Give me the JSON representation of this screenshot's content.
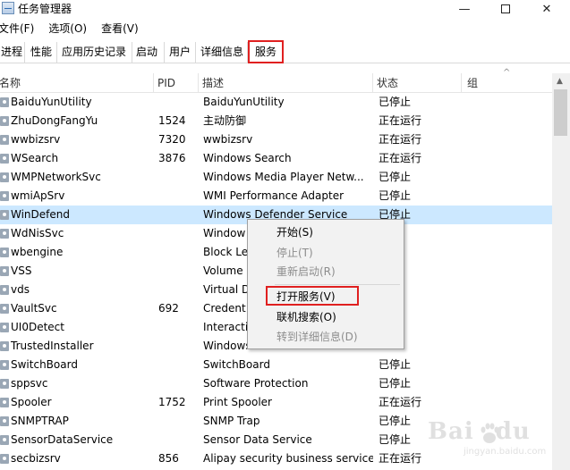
{
  "window": {
    "title": "任务管理器",
    "min_glyph": "—",
    "close_glyph": "✕"
  },
  "menu": [
    "文件(F)",
    "选项(O)",
    "查看(V)"
  ],
  "tabs": [
    "进程",
    "性能",
    "应用历史记录",
    "启动",
    "用户",
    "详细信息"
  ],
  "active_tab": "服务",
  "columns": {
    "name": "名称",
    "pid": "PID",
    "desc": "描述",
    "status": "状态",
    "group": "组"
  },
  "services": [
    {
      "name": "BaiduYunUtility",
      "pid": "",
      "desc": "BaiduYunUtility",
      "status": "已停止"
    },
    {
      "name": "ZhuDongFangYu",
      "pid": "1524",
      "desc": "主动防御",
      "status": "正在运行"
    },
    {
      "name": "wwbizsrv",
      "pid": "7320",
      "desc": "wwbizsrv",
      "status": "正在运行"
    },
    {
      "name": "WSearch",
      "pid": "3876",
      "desc": "Windows Search",
      "status": "正在运行"
    },
    {
      "name": "WMPNetworkSvc",
      "pid": "",
      "desc": "Windows Media Player Netw...",
      "status": "已停止"
    },
    {
      "name": "wmiApSrv",
      "pid": "",
      "desc": "WMI Performance Adapter",
      "status": "已停止"
    },
    {
      "name": "WinDefend",
      "pid": "",
      "desc": "Windows Defender Service",
      "status": "已停止"
    },
    {
      "name": "WdNisSvc",
      "pid": "",
      "desc": "Window",
      "status": ""
    },
    {
      "name": "wbengine",
      "pid": "",
      "desc": "Block Le",
      "status": ""
    },
    {
      "name": "VSS",
      "pid": "",
      "desc": "Volume",
      "status": ""
    },
    {
      "name": "vds",
      "pid": "",
      "desc": "Virtual D",
      "status": ""
    },
    {
      "name": "VaultSvc",
      "pid": "692",
      "desc": "Credent",
      "status": "行"
    },
    {
      "name": "UI0Detect",
      "pid": "",
      "desc": "Interacti",
      "status": ""
    },
    {
      "name": "TrustedInstaller",
      "pid": "",
      "desc": "Windows Modules Installer",
      "status": ""
    },
    {
      "name": "SwitchBoard",
      "pid": "",
      "desc": "SwitchBoard",
      "status": "已停止"
    },
    {
      "name": "sppsvc",
      "pid": "",
      "desc": "Software Protection",
      "status": "已停止"
    },
    {
      "name": "Spooler",
      "pid": "1752",
      "desc": "Print Spooler",
      "status": "正在运行"
    },
    {
      "name": "SNMPTRAP",
      "pid": "",
      "desc": "SNMP Trap",
      "status": "已停止"
    },
    {
      "name": "SensorDataService",
      "pid": "",
      "desc": "Sensor Data Service",
      "status": "已停止"
    },
    {
      "name": "secbizsrv",
      "pid": "856",
      "desc": "Alipay security business service",
      "status": "正在运行"
    }
  ],
  "context_menu": {
    "start": "开始(S)",
    "stop": "停止(T)",
    "restart": "重新启动(R)",
    "open_services": "打开服务(V)",
    "search_online": "联机搜索(O)",
    "go_details": "转到详细信息(D)"
  },
  "watermark": {
    "text": "Bai",
    "text2": "du",
    "sub": "jingyan.baidu.com"
  },
  "colors": {
    "selected_row": "#cce8ff",
    "highlight_box": "#e02020"
  }
}
